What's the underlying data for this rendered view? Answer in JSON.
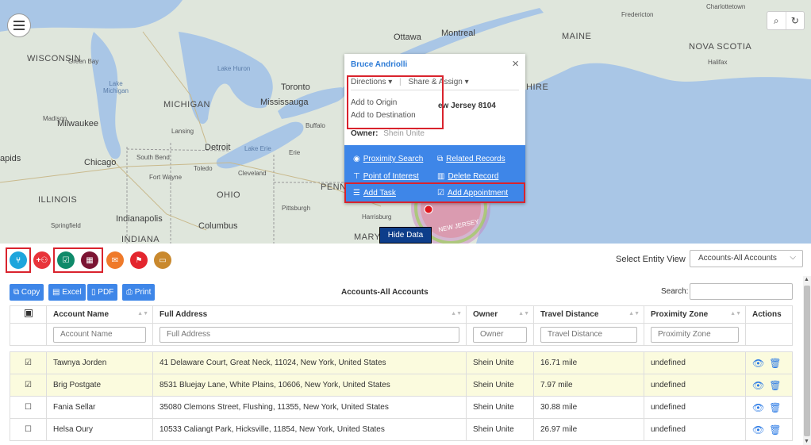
{
  "map": {
    "states": [
      "WISCONSIN",
      "MICHIGAN",
      "ILLINOIS",
      "INDIANA",
      "OHIO",
      "PENN",
      "MAINE",
      "NOVA SCOTIA"
    ],
    "cities": [
      "Milwaukee",
      "Chicago",
      "Detroit",
      "Toronto",
      "Mississauga",
      "Ottawa",
      "Montreal",
      "Indianapolis",
      "Columbus",
      "Harrisburg"
    ],
    "small_cities": [
      "Green Bay",
      "Madison",
      "Lansing",
      "South Bend",
      "Toledo",
      "Fort Wayne",
      "Cleveland",
      "Erie",
      "Buffalo",
      "Pittsburgh",
      "Springfield",
      "Fredericton",
      "Charlottetown",
      "Halifax"
    ],
    "lakes": [
      "Lake Huron",
      "Lake Michigan",
      "Lake Erie"
    ],
    "partial_labels": [
      "apids",
      "MARY",
      "NEW JERSEY",
      "HIRE"
    ],
    "menu_icon": "hamburger-icon",
    "tools": [
      {
        "icon": "search-icon",
        "glyph": "⌕"
      },
      {
        "icon": "refresh-icon",
        "glyph": "↻"
      }
    ]
  },
  "popup": {
    "title": "Bruce Andriolli",
    "close": "×",
    "tab_directions": "Directions ▾",
    "tab_share": "Share & Assign ▾",
    "dropdown": [
      "Add to Origin",
      "Add to Destination"
    ],
    "address_fragment": "ew Jersey 8104",
    "owner_label": "Owner:",
    "owner_value": "Shein Unite",
    "actions": {
      "proximity": "Proximity Search",
      "related": "Related Records",
      "poi": "Point of Interest",
      "delete": "Delete Record",
      "task": "Add Task",
      "appointment": "Add Appointment"
    }
  },
  "hide_data": "Hide Data",
  "toolbar": {
    "entity_label": "Select Entity View",
    "entity_value": "Accounts-All Accounts",
    "buttons": [
      {
        "name": "route-icon",
        "color": "#1ea5dc"
      },
      {
        "name": "add-users-icon",
        "color": "#e8343b"
      },
      {
        "name": "task-icon",
        "color": "#0f8a6a"
      },
      {
        "name": "calendar-icon",
        "color": "#7b1433"
      },
      {
        "name": "email-icon",
        "color": "#ef7a2a"
      },
      {
        "name": "flag-icon",
        "color": "#e3262e"
      },
      {
        "name": "folder-icon",
        "color": "#c9892e"
      }
    ]
  },
  "grid": {
    "buttons": {
      "copy": "Copy",
      "excel": "Excel",
      "pdf": "PDF",
      "print": "Print"
    },
    "title": "Accounts-All Accounts",
    "search_label": "Search:",
    "columns": [
      "Account Name",
      "Full Address",
      "Owner",
      "Travel Distance",
      "Proximity Zone",
      "Actions"
    ],
    "filters": [
      "Account Name",
      "Full Address",
      "Owner",
      "Travel Distance",
      "Proximity Zone"
    ],
    "rows": [
      {
        "checked": "☑",
        "selected": true,
        "name": "Tawnya Jorden",
        "address": "41 Delaware Court, Great Neck, 11024, New York, United States",
        "owner": "Shein Unite",
        "distance": "16.71 mile",
        "zone": "undefined"
      },
      {
        "checked": "☑",
        "selected": true,
        "name": "Brig Postgate",
        "address": "8531 Bluejay Lane, White Plains, 10606, New York, United States",
        "owner": "Shein Unite",
        "distance": "7.97 mile",
        "zone": "undefined"
      },
      {
        "checked": "☐",
        "selected": false,
        "name": "Fania Sellar",
        "address": "35080 Clemons Street, Flushing, 11355, New York, United States",
        "owner": "Shein Unite",
        "distance": "30.88 mile",
        "zone": "undefined"
      },
      {
        "checked": "☐",
        "selected": false,
        "name": "Helsa Oury",
        "address": "10533 Caliangt Park, Hicksville, 11854, New York, United States",
        "owner": "Shein Unite",
        "distance": "26.97 mile",
        "zone": "undefined"
      }
    ]
  }
}
